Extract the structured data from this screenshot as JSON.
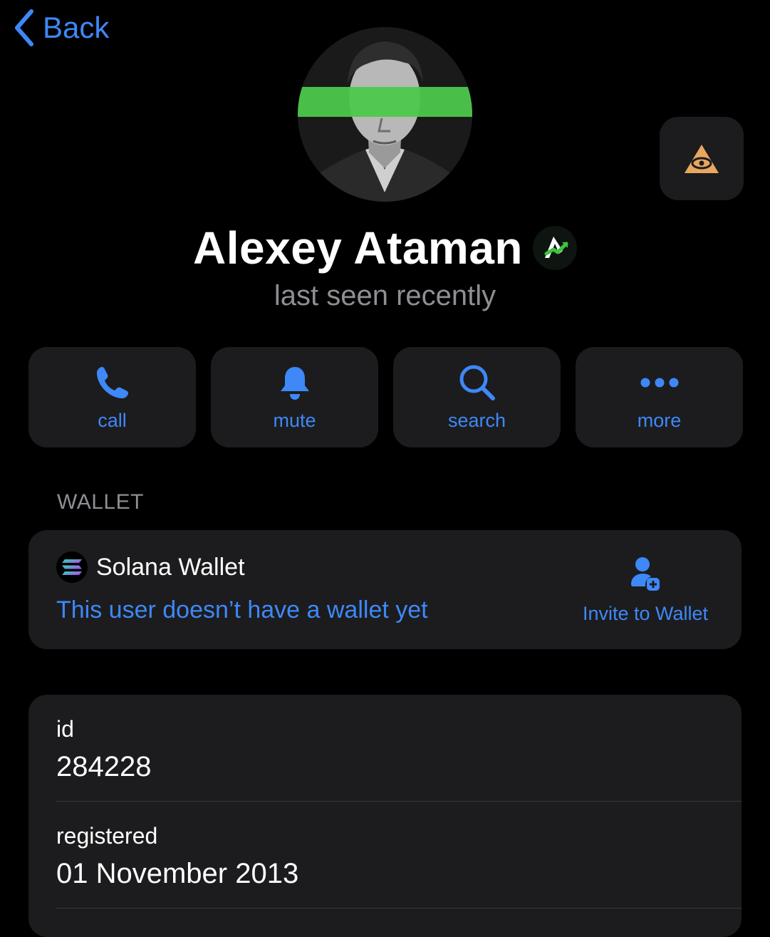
{
  "nav": {
    "back_label": "Back"
  },
  "profile": {
    "name": "Alexey Ataman",
    "status": "last seen recently"
  },
  "actions": [
    {
      "label": "call",
      "icon": "phone-icon"
    },
    {
      "label": "mute",
      "icon": "bell-icon"
    },
    {
      "label": "search",
      "icon": "magnifier-icon"
    },
    {
      "label": "more",
      "icon": "ellipsis-icon"
    }
  ],
  "wallet": {
    "section_header": "WALLET",
    "title": "Solana Wallet",
    "subtitle": "This user doesn’t have a wallet yet",
    "invite_label": "Invite to Wallet"
  },
  "info": {
    "rows": [
      {
        "key": "id",
        "value": "284228"
      },
      {
        "key": "registered",
        "value": "01 November 2013"
      }
    ]
  },
  "colors": {
    "accent": "#3e88f7",
    "background": "#000000",
    "card": "#1c1c1e",
    "secondary_text": "#8e8e93",
    "avatar_band": "#4cc84c",
    "eye_badge": "#e8a760"
  }
}
